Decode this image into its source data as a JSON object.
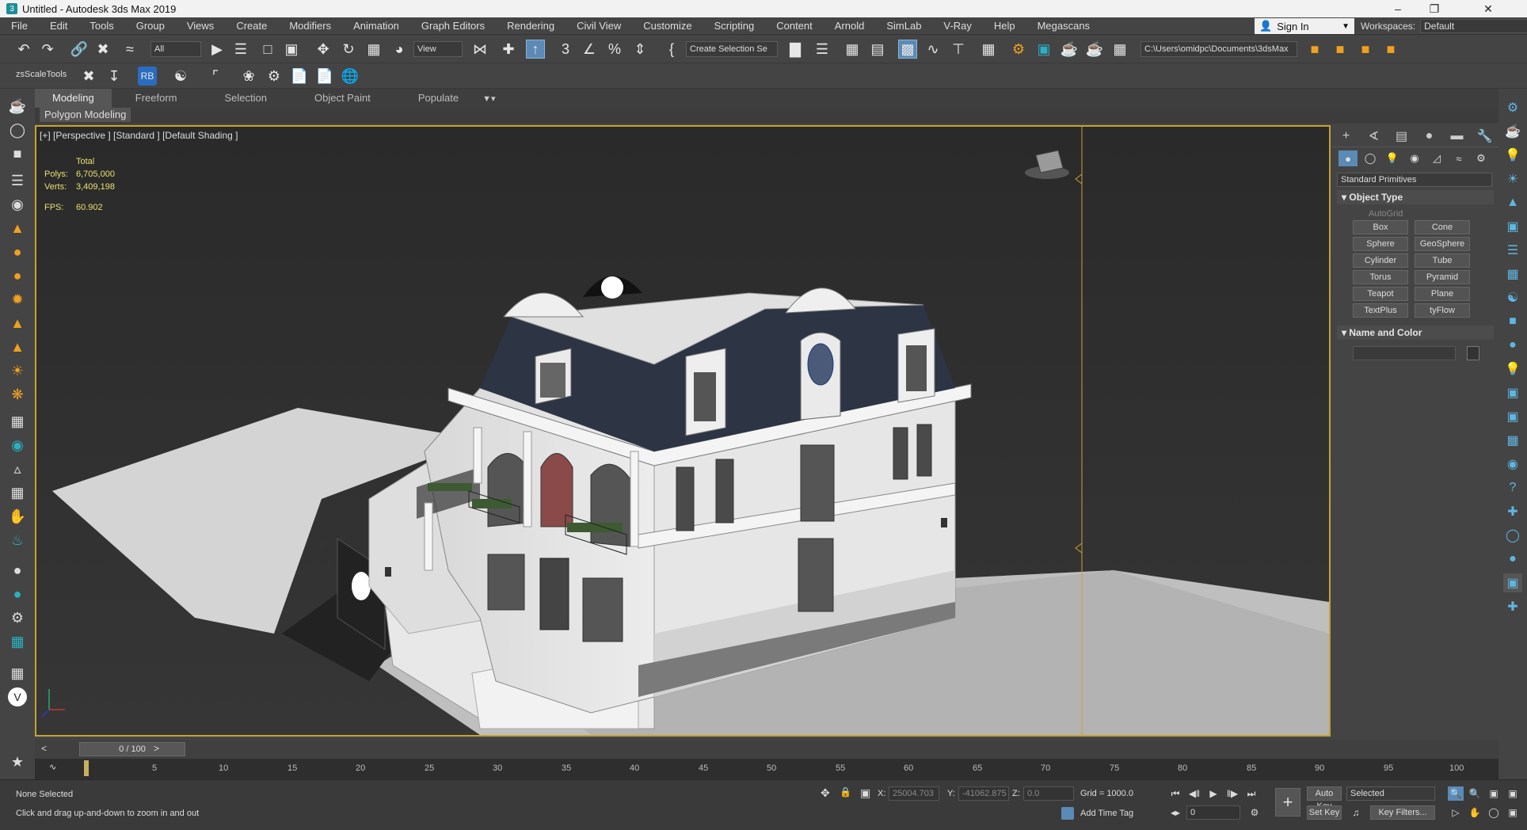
{
  "window": {
    "title": "Untitled - Autodesk 3ds Max 2019",
    "app_icon": "3ds-max-icon"
  },
  "menu": [
    "File",
    "Edit",
    "Tools",
    "Group",
    "Views",
    "Create",
    "Modifiers",
    "Animation",
    "Graph Editors",
    "Rendering",
    "Civil View",
    "Customize",
    "Scripting",
    "Content",
    "Arnold",
    "SimLab",
    "V-Ray",
    "Help",
    "Megascans"
  ],
  "signin": "Sign In",
  "workspaces": {
    "label": "Workspaces:",
    "value": "Default"
  },
  "toolbar": {
    "selection_filter": "All",
    "ref_coord": "View",
    "named_selection": "Create Selection Se",
    "project_path": "C:\\Users\\omidpc\\Documents\\3dsMax",
    "zsscale": "zsScaleTools",
    "rb": "RB"
  },
  "ribbon": {
    "tabs": [
      "Modeling",
      "Freeform",
      "Selection",
      "Object Paint",
      "Populate"
    ],
    "active": "Modeling",
    "sub": "Polygon Modeling"
  },
  "viewport": {
    "label": "[+] [Perspective ] [Standard ] [Default Shading ]",
    "stats": {
      "header": "Total",
      "polys_label": "Polys:",
      "polys": "6,705,000",
      "verts_label": "Verts:",
      "verts": "3,409,198",
      "fps_label": "FPS:",
      "fps": "60.902"
    }
  },
  "command_panel": {
    "category": "Standard Primitives",
    "object_type": "Object Type",
    "autogrid": "AutoGrid",
    "buttons": [
      "Box",
      "Cone",
      "Sphere",
      "GeoSphere",
      "Cylinder",
      "Tube",
      "Torus",
      "Pyramid",
      "Teapot",
      "Plane",
      "TextPlus",
      "tyFlow"
    ],
    "name_and_color": "Name and Color"
  },
  "timeline": {
    "frame": "0 / 100",
    "ticks": [
      "5",
      "10",
      "15",
      "20",
      "25",
      "30",
      "35",
      "40",
      "45",
      "50",
      "55",
      "60",
      "65",
      "70",
      "75",
      "80",
      "85",
      "90",
      "95",
      "100"
    ]
  },
  "status": {
    "selection": "None Selected",
    "prompt": "Click and drag up-and-down to zoom in and out",
    "x_label": "X:",
    "x": "25004.703",
    "y_label": "Y:",
    "y": "-41062.875",
    "z_label": "Z:",
    "z": "0.0",
    "grid": "Grid = 1000.0",
    "add_time_tag": "Add Time Tag",
    "auto_key": "Auto Key",
    "set_key": "Set Key",
    "key_mode": "Selected",
    "key_filters": "Key Filters...",
    "current_frame": "0"
  },
  "colors": {
    "viewport_border": "#c8a233",
    "accent_blue": "#5a8ab5",
    "roof": "#2d3444",
    "walls": "#e4e4e4"
  }
}
